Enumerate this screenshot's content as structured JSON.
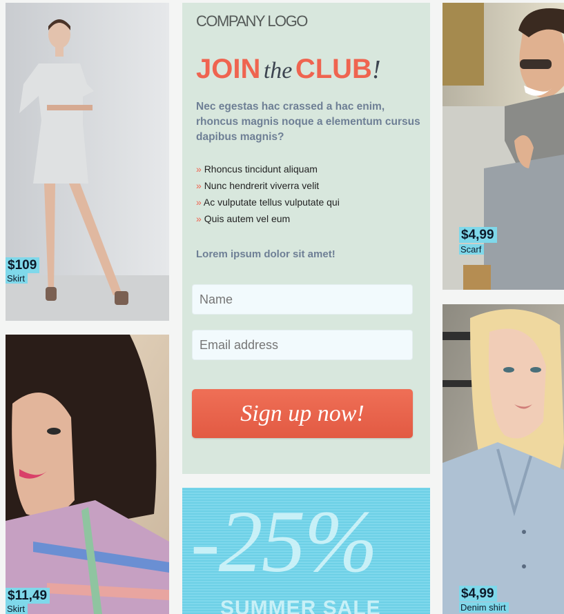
{
  "header": {
    "logo_text": "COMPANY LOGO"
  },
  "hero": {
    "headline_join": "JOIN",
    "headline_the": "the",
    "headline_club": "CLUB",
    "headline_excl": "!",
    "intro": "Nec egestas hac crassed a hac enim, rhoncus magnis noque a elementum cursus dapibus magnis?",
    "bullets": [
      "Rhoncus tincidunt aliquam",
      "Nunc hendrerit viverra velit",
      "Ac vulputate tellus vulputate qui",
      "Quis autem vel eum"
    ],
    "bullet_marker": "»",
    "tagline": "Lorem ipsum dolor sit amet!"
  },
  "form": {
    "name_placeholder": "Name",
    "email_placeholder": "Email address",
    "signup_label": "Sign up now!"
  },
  "sale": {
    "percent": "-25%",
    "label": "SUMMER SALE"
  },
  "products": [
    {
      "price": "$109",
      "type": "Skirt"
    },
    {
      "price": "$4,99",
      "type": "Scarf"
    },
    {
      "price": "$11,49",
      "type": "Skirt"
    },
    {
      "price": "$4,99",
      "type": "Denim shirt"
    }
  ],
  "colors": {
    "accent": "#ef6450",
    "card_bg": "#d8e7dd",
    "price_tag": "#7fd8ea",
    "sale_bg": "#6dd0e6",
    "intro_text": "#6e7f95"
  }
}
